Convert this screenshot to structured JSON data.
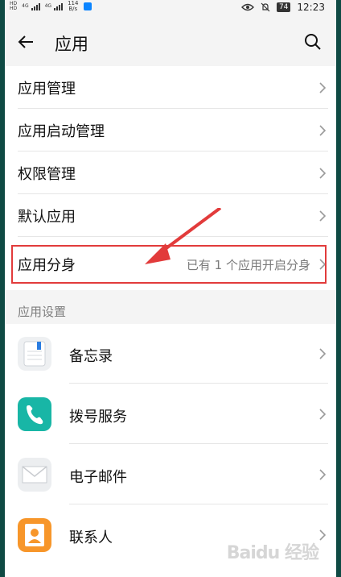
{
  "status_bar": {
    "sim_label": "HD",
    "net_type": "4G",
    "speed_value": "114",
    "speed_unit": "B/s",
    "battery": "74",
    "time": "12:23"
  },
  "header": {
    "title": "应用",
    "back_icon": "arrow-left-icon",
    "search_icon": "search-icon"
  },
  "menu": {
    "items": [
      {
        "label": "应用管理",
        "value": ""
      },
      {
        "label": "应用启动管理",
        "value": ""
      },
      {
        "label": "权限管理",
        "value": ""
      },
      {
        "label": "默认应用",
        "value": ""
      },
      {
        "label": "应用分身",
        "value": "已有 1 个应用开启分身"
      }
    ]
  },
  "app_settings": {
    "section_title": "应用设置",
    "apps": [
      {
        "name": "备忘录",
        "icon": "notes-icon",
        "color": "#eef0f2"
      },
      {
        "name": "拨号服务",
        "icon": "phone-icon",
        "color": "#18b6a6"
      },
      {
        "name": "电子邮件",
        "icon": "mail-icon",
        "color": "#eceef0"
      },
      {
        "name": "联系人",
        "icon": "contacts-icon",
        "color": "#f7962a"
      }
    ]
  },
  "annotation": {
    "highlight_color": "#e23b3b"
  },
  "watermark": "Baidu 经验"
}
